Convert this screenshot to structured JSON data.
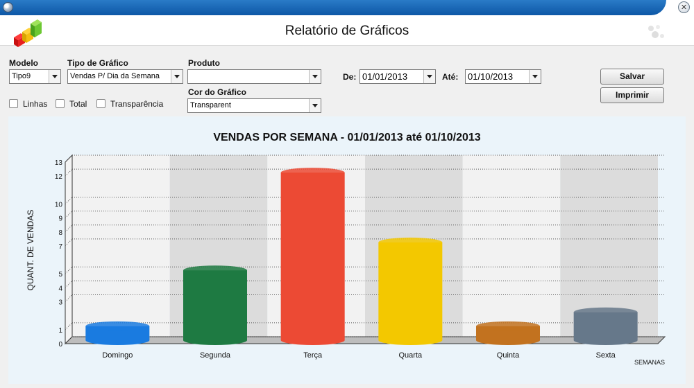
{
  "window": {
    "close_glyph": "✕"
  },
  "header": {
    "title": "Relatório de Gráficos"
  },
  "filters": {
    "modelo_label": "Modelo",
    "modelo_value": "Tipo9",
    "tipo_label": "Tipo de Gráfico",
    "tipo_value": "Vendas P/ Dia da Semana",
    "produto_label": "Produto",
    "produto_value": "",
    "cor_label": "Cor do Gráfico",
    "cor_value": "Transparent",
    "de_label": "De:",
    "de_value": "01/01/2013",
    "ate_label": "Até:",
    "ate_value": "01/10/2013",
    "linhas_label": "Linhas",
    "total_label": "Total",
    "transparencia_label": "Transparência"
  },
  "buttons": {
    "salvar": "Salvar",
    "imprimir": "Imprimir"
  },
  "chart_data": {
    "type": "bar",
    "title": "VENDAS POR SEMANA -  01/01/2013 até 01/10/2013",
    "xlabel": "SEMANAS",
    "ylabel": "QUANT. DE VENDAS",
    "categories": [
      "Domingo",
      "Segunda",
      "Terça",
      "Quarta",
      "Quinta",
      "Sexta"
    ],
    "values": [
      1,
      5,
      12,
      7,
      1,
      2
    ],
    "colors": [
      "#1a7be0",
      "#1e7a42",
      "#ec4a34",
      "#f3c800",
      "#c2721f",
      "#66788a"
    ],
    "yticks": [
      0,
      1,
      3,
      4,
      5,
      7,
      8,
      9,
      10,
      12,
      13
    ],
    "ylim": [
      0,
      13
    ],
    "grid": true
  }
}
